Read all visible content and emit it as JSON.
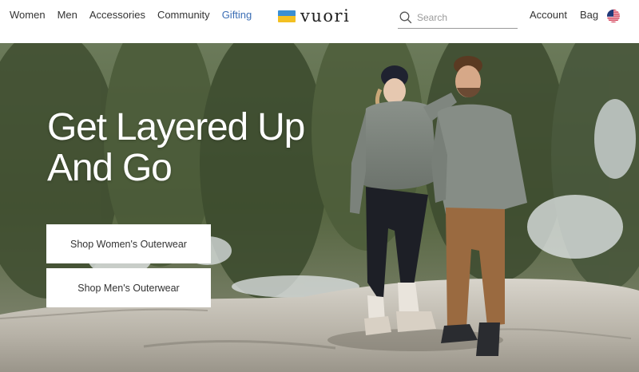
{
  "header": {
    "nav_left": [
      {
        "label": "Women"
      },
      {
        "label": "Men"
      },
      {
        "label": "Accessories"
      },
      {
        "label": "Community"
      },
      {
        "label": "Gifting"
      }
    ],
    "logo_text": "vuori",
    "search_placeholder": "Search",
    "nav_right": [
      {
        "label": "Account"
      },
      {
        "label": "Bag"
      }
    ],
    "flag_icon": "us-flag-icon"
  },
  "hero": {
    "headline_line1": "Get Layered Up",
    "headline_line2": "And Go",
    "cta_women": "Shop Women's Outerwear",
    "cta_men": "Shop Men's Outerwear"
  },
  "colors": {
    "accent_link": "#3b6eb5",
    "logo_blue": "#3a8fd4",
    "logo_yellow": "#f3c022"
  }
}
